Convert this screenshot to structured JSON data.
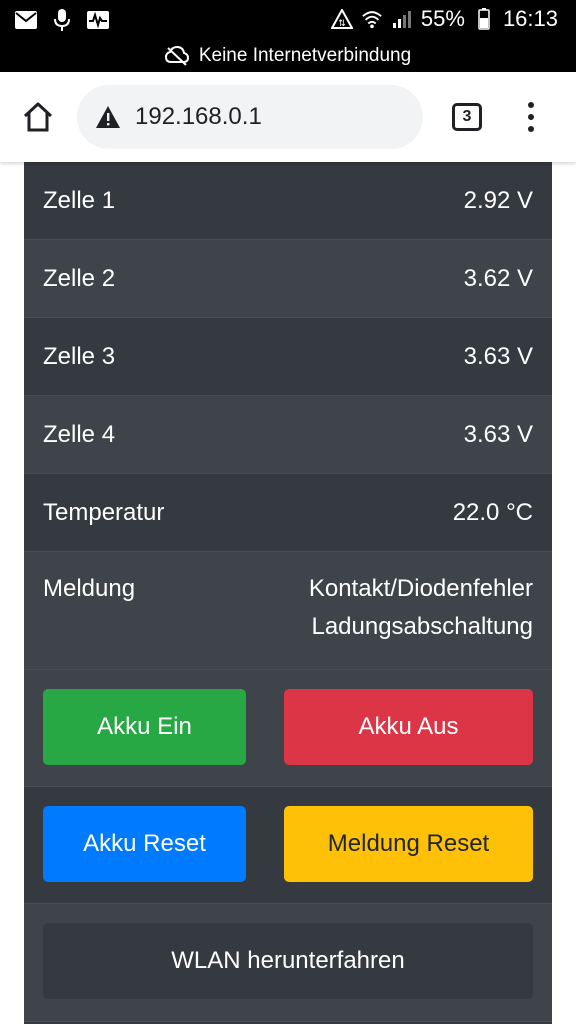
{
  "status_bar": {
    "battery_percent": "55%",
    "time": "16:13",
    "icons": [
      "mail-icon",
      "microphone-icon",
      "activity-icon",
      "data-saver-icon",
      "wifi-icon",
      "signal-icon",
      "battery-icon"
    ]
  },
  "offline_banner": {
    "text": "Keine Internetverbindung",
    "icon": "cloud-off-icon"
  },
  "browser": {
    "url": "192.168.0.1",
    "tab_count": "3",
    "icons": [
      "home-icon",
      "warning-icon",
      "tabs-icon",
      "more-vert-icon"
    ]
  },
  "table": {
    "rows": [
      {
        "label": "Zelle 1",
        "value": "2.92 V"
      },
      {
        "label": "Zelle 2",
        "value": "3.62 V"
      },
      {
        "label": "Zelle 3",
        "value": "3.63 V"
      },
      {
        "label": "Zelle 4",
        "value": "3.63 V"
      },
      {
        "label": "Temperatur",
        "value": "22.0 °C"
      }
    ],
    "message": {
      "label": "Meldung",
      "lines": [
        "Kontakt/Diodenfehler",
        "Ladungsabschaltung"
      ]
    }
  },
  "buttons": {
    "akku_ein": "Akku Ein",
    "akku_aus": "Akku Aus",
    "akku_reset": "Akku Reset",
    "meldung_reset": "Meldung Reset",
    "wlan_off": "WLAN herunterfahren"
  },
  "colors": {
    "panel": "#343a40",
    "panel_alt": "#3e444a",
    "success": "#28a745",
    "danger": "#dc3545",
    "primary": "#007bff",
    "warning": "#ffc107",
    "dark": "#343a40"
  }
}
